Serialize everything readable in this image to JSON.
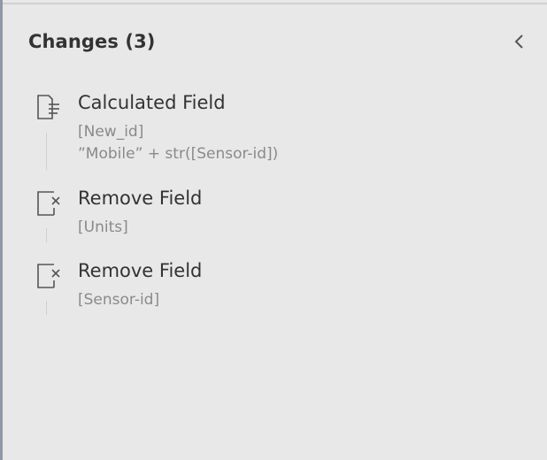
{
  "panel": {
    "title": "Changes (3)",
    "collapse_icon": "chevron-left-icon"
  },
  "changes": [
    {
      "title": "Calculated Field",
      "icon": "calculated-field-icon",
      "details": [
        "[New_id]",
        "”Mobile” + str([Sensor-id])"
      ]
    },
    {
      "title": "Remove Field",
      "icon": "remove-field-icon",
      "details": [
        "[Units]"
      ]
    },
    {
      "title": "Remove Field",
      "icon": "remove-field-icon",
      "details": [
        "[Sensor-id]"
      ]
    }
  ],
  "colors": {
    "background": "#e8e8e8",
    "title_text": "#333333",
    "detail_text": "#8a8a8a",
    "icon_stroke": "#555555"
  }
}
